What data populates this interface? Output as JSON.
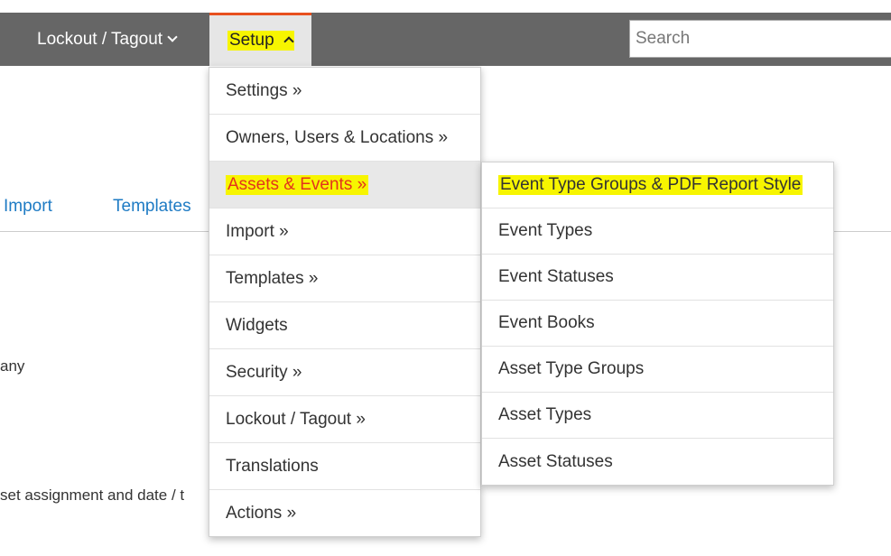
{
  "topbar": {
    "lockout_label": "Lockout / Tagout",
    "setup_label": "Setup",
    "search_placeholder": "Search"
  },
  "tabs": [
    "Import",
    "Templates"
  ],
  "background_text": {
    "line1": "any",
    "line2": "set assignment and date / t"
  },
  "setup_menu": [
    {
      "label": "Settings »"
    },
    {
      "label": "Owners, Users & Locations »"
    },
    {
      "label": "Assets & Events »",
      "active": true
    },
    {
      "label": "Import »"
    },
    {
      "label": "Templates »"
    },
    {
      "label": "Widgets"
    },
    {
      "label": "Security »"
    },
    {
      "label": "Lockout / Tagout  »"
    },
    {
      "label": "Translations"
    },
    {
      "label": "Actions  »"
    }
  ],
  "assets_events_submenu": [
    {
      "label": "Event Type Groups & PDF Report Style",
      "highlighted": true
    },
    {
      "label": "Event Types"
    },
    {
      "label": "Event Statuses"
    },
    {
      "label": "Event Books"
    },
    {
      "label": "Asset Type Groups"
    },
    {
      "label": "Asset Types"
    },
    {
      "label": "Asset Statuses"
    }
  ],
  "colors": {
    "topbar": "#666666",
    "accent": "#e8501e",
    "active_text": "#e3341d",
    "highlight": "#f7f500",
    "link": "#1e7bc4"
  }
}
